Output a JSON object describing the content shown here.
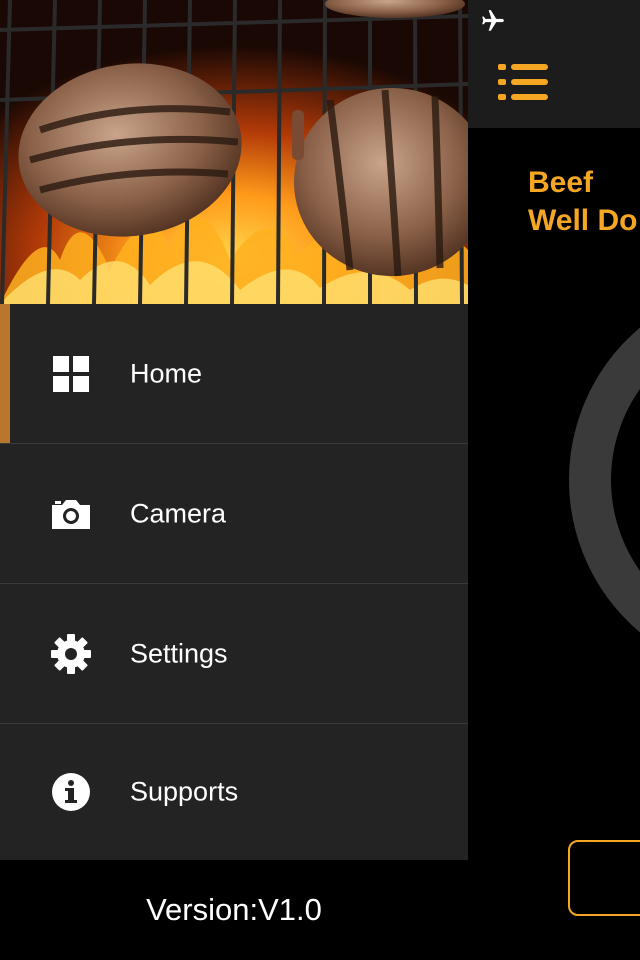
{
  "drawer": {
    "items": [
      {
        "label": "Home",
        "icon": "grid-icon",
        "active": true
      },
      {
        "label": "Camera",
        "icon": "camera-icon",
        "active": false
      },
      {
        "label": "Settings",
        "icon": "gear-icon",
        "active": false
      },
      {
        "label": "Supports",
        "icon": "info-icon",
        "active": false
      }
    ],
    "version": "Version:V1.0"
  },
  "main": {
    "meat_type": "Beef",
    "doneness": "Well Do"
  },
  "colors": {
    "accent": "#f5a623",
    "active_bar": "#b8772a",
    "drawer_bg": "#232323",
    "divider": "#3a3a3a"
  }
}
